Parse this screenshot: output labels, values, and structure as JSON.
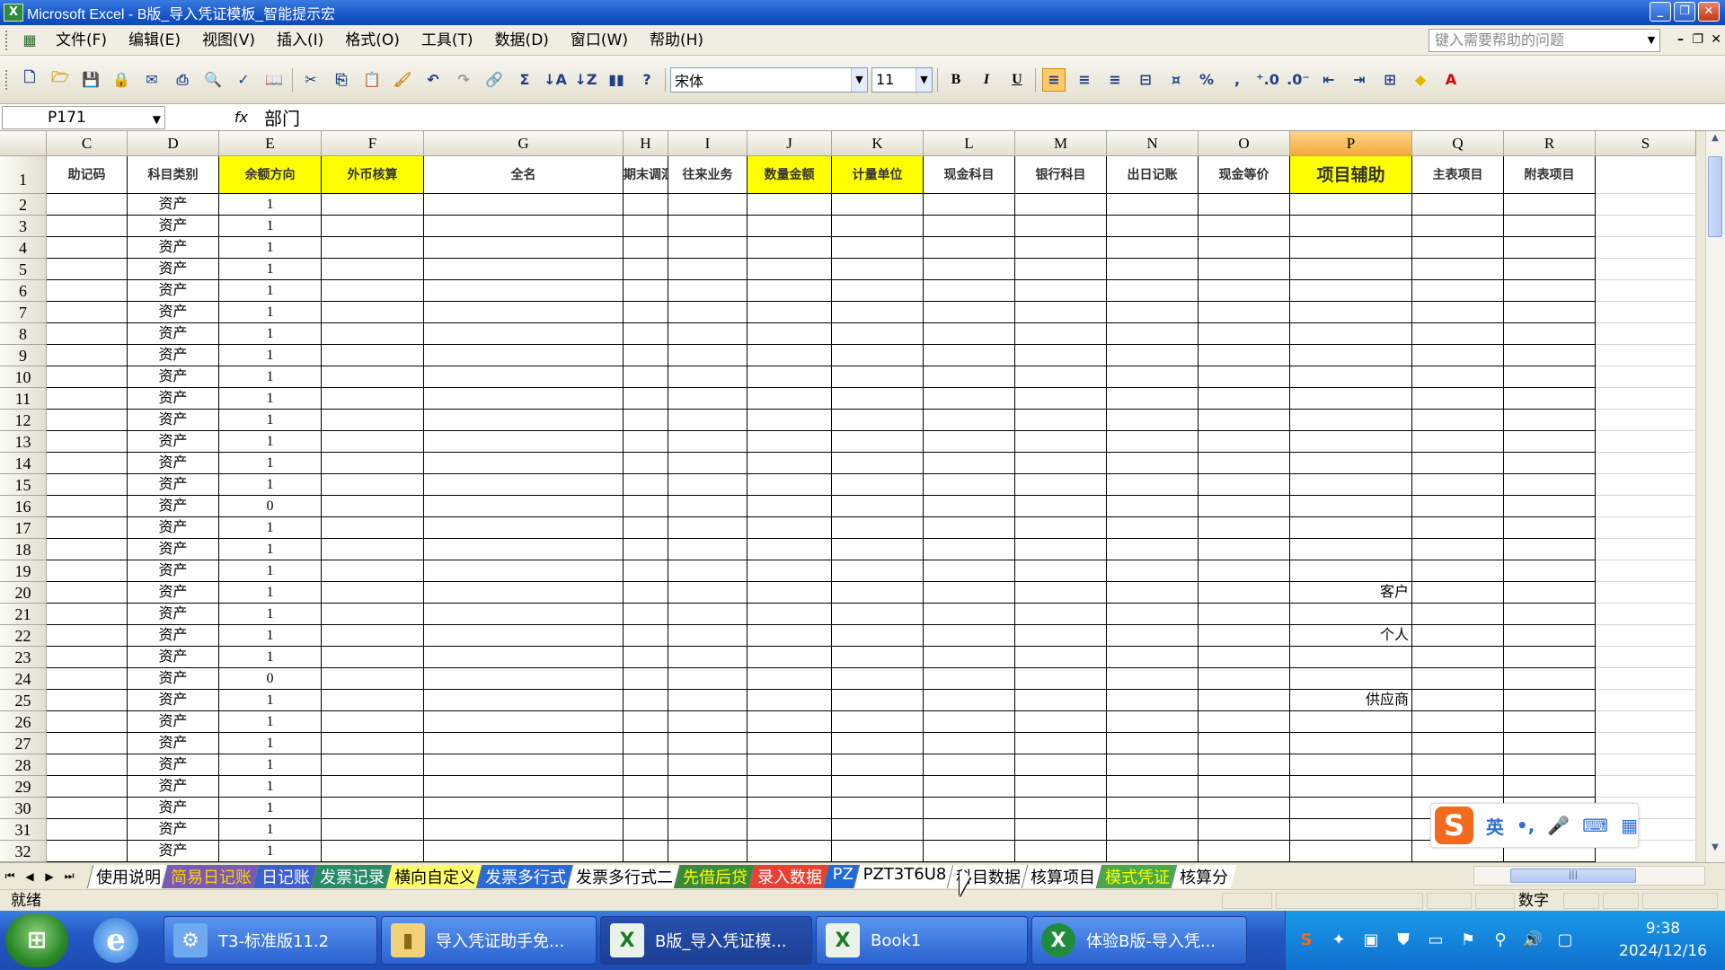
{
  "window": {
    "title": "Microsoft Excel - B版_导入凭证模板_智能提示宏",
    "app_icon": "excel-icon",
    "buttons": [
      "minimize",
      "maximize",
      "close"
    ]
  },
  "menu": {
    "items": [
      "文件(F)",
      "编辑(E)",
      "视图(V)",
      "插入(I)",
      "格式(O)",
      "工具(T)",
      "数据(D)",
      "窗口(W)",
      "帮助(H)"
    ],
    "help_placeholder": "键入需要帮助的问题"
  },
  "toolbar": {
    "font_name": "宋体",
    "font_size": "11",
    "bold": "B",
    "italic": "I",
    "underline": "U",
    "percent": "%",
    "comma": ","
  },
  "formula_bar": {
    "name_box": "P171",
    "fx": "fx",
    "formula": "部门"
  },
  "sheet": {
    "columns": [
      "C",
      "D",
      "E",
      "F",
      "G",
      "H",
      "I",
      "J",
      "K",
      "L",
      "M",
      "N",
      "O",
      "P",
      "Q",
      "R",
      "S"
    ],
    "active_column": "P",
    "header_row": [
      "助记码",
      "科目类别",
      "余额方向",
      "外币核算",
      "全名",
      "期末调汇",
      "往来业务",
      "数量金额",
      "计量单位",
      "现金科目",
      "银行科目",
      "出日记账",
      "现金等价",
      "项目辅助",
      "主表项目",
      "附表项目",
      ""
    ],
    "yellow_headers": [
      "E",
      "F",
      "J",
      "K",
      "P"
    ],
    "category_value": "资产",
    "balance_direction": [
      "1",
      "1",
      "1",
      "1",
      "1",
      "1",
      "1",
      "1",
      "1",
      "1",
      "1",
      "1",
      "1",
      "1",
      "0",
      "1",
      "1",
      "1",
      "1",
      "1",
      "1",
      "1",
      "0",
      "1",
      "1",
      "1",
      "1",
      "1",
      "1",
      "1",
      "1"
    ],
    "p_column_values": {
      "20": "客户",
      "22": "个人",
      "25": "供应商"
    }
  },
  "tabs": [
    {
      "label": "使用说明",
      "color": "#ffffff",
      "text": "#000000"
    },
    {
      "label": "简易日记账",
      "color": "#7a5ab4",
      "text": "#ffd200"
    },
    {
      "label": "日记账",
      "color": "#3d5fd1",
      "text": "#ffffff"
    },
    {
      "label": "发票记录",
      "color": "#2a8a6a",
      "text": "#ffffff"
    },
    {
      "label": "横向自定义",
      "color": "#ffff66",
      "text": "#000000"
    },
    {
      "label": "发票多行式",
      "color": "#2a6ad8",
      "text": "#ffffff"
    },
    {
      "label": "发票多行式二",
      "color": "#ffffff",
      "text": "#000000"
    },
    {
      "label": "先借后贷",
      "color": "#3a8a3a",
      "text": "#ffff00"
    },
    {
      "label": "录入数据",
      "color": "#e84033",
      "text": "#ffffff"
    },
    {
      "label": "PZ",
      "color": "#1e6ad6",
      "text": "#ffffff"
    },
    {
      "label": "PZT3T6U8",
      "color": "#ffffff",
      "text": "#000000"
    },
    {
      "label": "科目数据",
      "color": "#ffffff",
      "text": "#000000"
    },
    {
      "label": "核算项目",
      "color": "#ffffff",
      "text": "#000000"
    },
    {
      "label": "模式凭证",
      "color": "#4aa84a",
      "text": "#ffff00"
    },
    {
      "label": "核算分",
      "color": "#ffffff",
      "text": "#000000"
    }
  ],
  "status": {
    "ready": "就绪",
    "mode": "数字"
  },
  "ime": {
    "lang": "英"
  },
  "taskbar": {
    "tasks": [
      "T3-标准版11.2",
      "导入凭证助手免...",
      "B版_导入凭证模...",
      "Book1",
      "体验B版-导入凭..."
    ],
    "time": "9:38",
    "date": "2024/12/16"
  }
}
